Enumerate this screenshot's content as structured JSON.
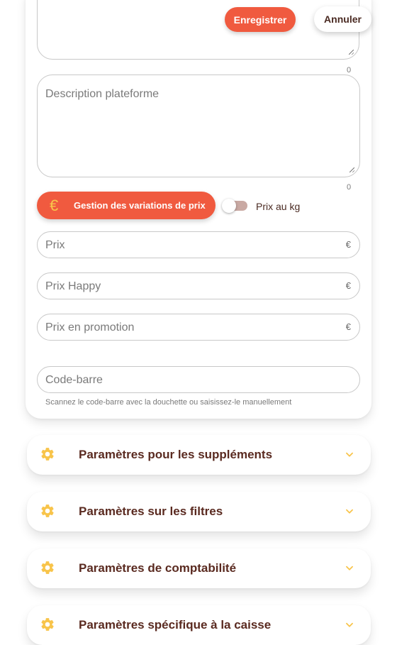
{
  "toolbar": {
    "save_label": "Enregistrer",
    "cancel_label": "Annuler"
  },
  "form": {
    "top_textarea_counter": "0",
    "description_placeholder": "Description plateforme",
    "description_counter": "0",
    "variations_button_label": "Gestion des variations de prix",
    "variations_icon": "€",
    "price_per_kg_label": "Prix au kg",
    "price_per_kg_enabled": false,
    "price_placeholder": "Prix",
    "happy_price_placeholder": "Prix Happy",
    "promo_price_placeholder": "Prix en promotion",
    "currency_symbol": "€",
    "barcode_placeholder": "Code-barre",
    "barcode_hint": "Scannez le code-barre avec la douchette ou saisissez-le manuellement"
  },
  "sections": [
    {
      "title": "Paramètres pour les suppléments",
      "icon": "gear-icon",
      "expanded": false
    },
    {
      "title": "Paramètres sur les filtres",
      "icon": "gear-icon",
      "expanded": false
    },
    {
      "title": "Paramètres de comptabilité",
      "icon": "gear-icon",
      "expanded": false
    },
    {
      "title": "Paramètres spécifique à la caisse",
      "icon": "gear-icon",
      "expanded": false
    }
  ],
  "colors": {
    "accent": "#f05a3f",
    "icon_yellow": "#f8c44a",
    "title_text": "#5a2a20",
    "toggle_track": "#c9a9a3"
  }
}
